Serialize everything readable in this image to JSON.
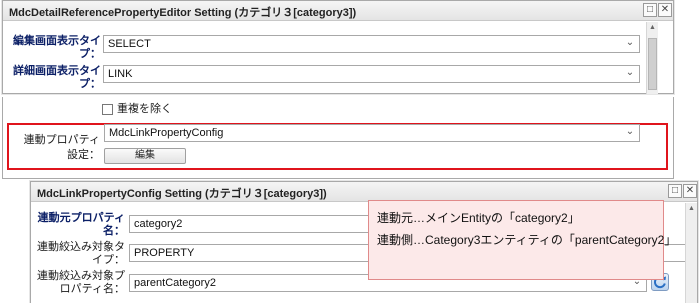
{
  "window1": {
    "title": "MdcDetailReferencePropertyEditor Setting (カテゴリ３[category3])",
    "edit_display_type": {
      "label": "編集画面表示タイプ：",
      "value": "SELECT"
    },
    "detail_display_type": {
      "label": "詳細画面表示タイプ：",
      "value": "LINK"
    },
    "dedupe_label": "重複を除く",
    "linked_property": {
      "label": "連動プロパティ設定：",
      "value": "MdcLinkPropertyConfig",
      "edit_button": "編集"
    }
  },
  "window2": {
    "title": "MdcLinkPropertyConfig Setting (カテゴリ３[category3])",
    "source_property": {
      "label": "連動元プロパティ名：",
      "value": "category2"
    },
    "filter_target_type": {
      "label": "連動絞込み対象タイプ：",
      "value": "PROPERTY"
    },
    "filter_target_property": {
      "label": "連動絞込み対象プロパティ名：",
      "value": "parentCategory2"
    }
  },
  "annotation": {
    "line1": "連動元…メインEntityの「category2」",
    "line2": "連動側…Category3エンティティの「parentCategory2」"
  },
  "colors": {
    "highlight_border": "#e0141c",
    "note_background": "#fce9e9"
  },
  "icons": [
    "minimize-icon",
    "close-icon",
    "chevron-down-icon",
    "scroll-up-icon",
    "scroll-down-icon",
    "refresh-icon"
  ]
}
